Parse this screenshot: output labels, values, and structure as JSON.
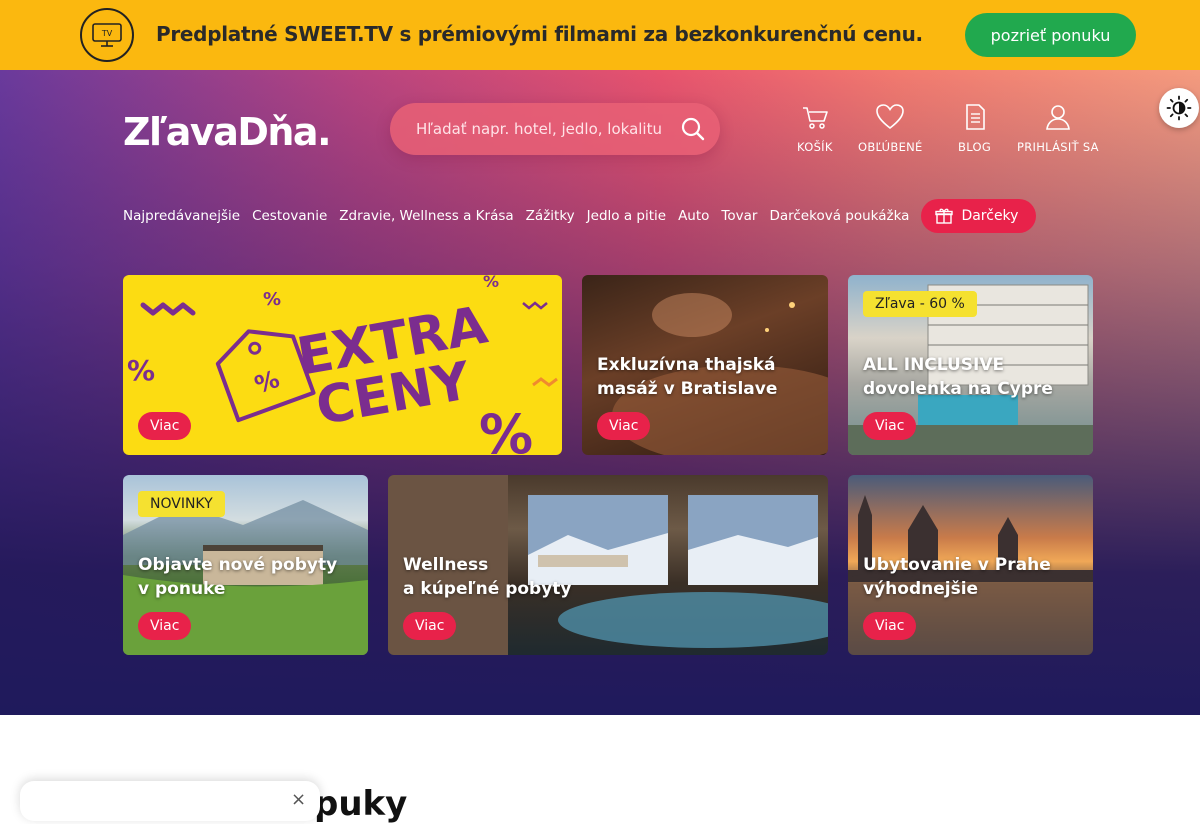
{
  "promo": {
    "tv_label": "TV",
    "text": "Predplatné SWEET.TV s prémiovými filmami za bezkonkurenčnú cenu.",
    "button": "pozrieť ponuku"
  },
  "header": {
    "logo": "ZľavaDňa.",
    "search_placeholder": "Hľadať napr. hotel, jedlo, lokalitu",
    "links": {
      "cart": "KOŠÍK",
      "favorites": "OBĽÚBENÉ",
      "blog": "BLOG",
      "login": "PRIHLÁSIŤ SA"
    }
  },
  "nav": {
    "items": [
      "Najpredávanejšie",
      "Cestovanie",
      "Zdravie, Wellness a Krása",
      "Zážitky",
      "Jedlo a pitie",
      "Auto",
      "Tovar",
      "Darčeková poukážka"
    ],
    "gift_button": "Darčeky"
  },
  "cards": {
    "extra": {
      "headline_1": "EXTRA",
      "headline_2": "CENY",
      "more": "Viac"
    },
    "masaz": {
      "title_1": "Exkluzívna thajská",
      "title_2": "masáž v Bratislave",
      "more": "Viac"
    },
    "cyprus": {
      "badge": "Zľava - 60 %",
      "title_1": "ALL INCLUSIVE",
      "title_2": "dovolenka na Cypre",
      "more": "Viac"
    },
    "novinky": {
      "badge": "NOVINKY",
      "title_1": "Objavte nové pobyty",
      "title_2": "v ponuke",
      "more": "Viac"
    },
    "wellness": {
      "title_1": "Wellness",
      "title_2": "a kúpeľné pobyty",
      "more": "Viac"
    },
    "praha": {
      "title_1": "Ubytovanie v Prahe",
      "title_2": "výhodnejšie",
      "more": "Viac"
    }
  },
  "bottom": {
    "section_title": "puky",
    "close": "×"
  },
  "colors": {
    "promo_bg": "#fbb80f",
    "promo_button": "#21a94e",
    "accent_red": "#e8224a",
    "badge_yellow": "#f5e130"
  }
}
